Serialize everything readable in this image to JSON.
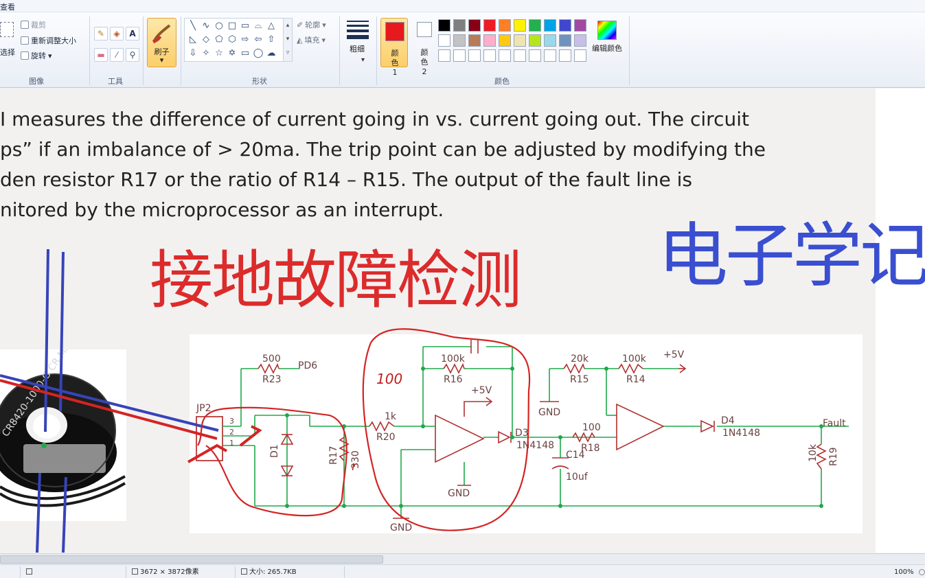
{
  "menu": {
    "view_label": "查看"
  },
  "ribbon": {
    "image_group": {
      "label": "图像",
      "select_label": "选择",
      "crop_label": "裁剪",
      "resize_label": "重新调整大小",
      "rotate_label": "旋转"
    },
    "tools_group": {
      "label": "工具",
      "tools": [
        "pencil-icon",
        "fill-icon",
        "text-icon",
        "eraser-icon",
        "color-picker-icon",
        "magnifier-icon"
      ],
      "text_tool_glyph": "A"
    },
    "brushes": {
      "label": "刷子"
    },
    "shapes_group": {
      "label": "形状",
      "outline_label": "轮廓",
      "fill_label": "填充",
      "shape_glyphs": [
        "╲",
        "∿",
        "○",
        "□",
        "▭",
        "⌓",
        "△",
        "◺",
        "◇",
        "⬠",
        "⬡",
        "⇨",
        "⇦",
        "⇧",
        "⇩",
        "✧",
        "☆",
        "✡",
        "▭",
        "◯",
        "☁"
      ]
    },
    "size": {
      "label": "粗细"
    },
    "colors_group": {
      "label": "颜色",
      "color1_label": "颜色 1",
      "color2_label": "颜色 2",
      "color1": "#e8191c",
      "color2": "#ffffff",
      "palette": [
        "#000000",
        "#7f7f7f",
        "#880015",
        "#ed1c24",
        "#ff7f27",
        "#fff200",
        "#22b14c",
        "#00a2e8",
        "#3f48cc",
        "#a349a4",
        "#ffffff",
        "#c3c3c3",
        "#b97a57",
        "#ffaec9",
        "#ffc90e",
        "#efe4b0",
        "#b5e61d",
        "#99d9ea",
        "#7092be",
        "#c8bfe7",
        "#ffffff",
        "#ffffff",
        "#ffffff",
        "#ffffff",
        "#ffffff",
        "#ffffff",
        "#ffffff",
        "#ffffff",
        "#ffffff",
        "#ffffff"
      ],
      "edit_colors_label": "编辑颜色"
    }
  },
  "canvas": {
    "paragraph": [
      "I measures the difference of current going in vs. current going out. The circuit",
      "ps” if an imbalance of > 20ma. The trip point can be adjusted by modifying the",
      "den resistor R17  or the ratio of R14 – R15. The output of the fault line is",
      "nitored by the microprocessor as an interrupt."
    ],
    "title_red": "接地故障检测",
    "watermark": "电子学记",
    "schematic": {
      "labels": {
        "jp2": "JP2",
        "pin3": "3",
        "pin2": "2",
        "pin1": "1",
        "r23_val": "500",
        "r23": "R23",
        "pd6": "PD6",
        "d1": "D1",
        "r17": "R17",
        "r17_val": "330",
        "r20_val": "1k",
        "r20": "R20",
        "r16_val": "100k",
        "r16": "R16",
        "vcc1": "+5V",
        "gnd1": "GND",
        "gnd2": "GND",
        "gnd3": "GND",
        "d3": "D3",
        "d3_part": "1N4148",
        "c14": "C14",
        "c14_val": "10uf",
        "r15_val": "20k",
        "r15": "R15",
        "r14_val": "100k",
        "r14": "R14",
        "vcc2": "+5V",
        "r18_val": "100",
        "r18": "R18",
        "d4": "D4",
        "d4_part": "1N4148",
        "fault": "Fault",
        "r19_val": "10k",
        "r19": "R19"
      },
      "annotations": {
        "handwritten_100": "100",
        "handwritten_r": "r"
      }
    },
    "sensor_label": "CR8420-1000-G CR MAGNETICS"
  },
  "status": {
    "dimensions": "3672 × 3872像素",
    "size": "大小: 265.7KB",
    "zoom": "100%"
  }
}
